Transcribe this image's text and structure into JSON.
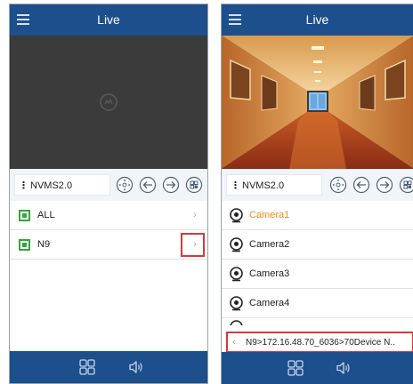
{
  "left_screen": {
    "title": "Live",
    "device": {
      "name": "NVMS2.0"
    },
    "list": [
      {
        "label": "ALL"
      },
      {
        "label": "N9"
      }
    ]
  },
  "right_screen": {
    "title": "Live",
    "device": {
      "name": "NVMS2.0"
    },
    "cameras": [
      {
        "label": "Camera1",
        "selected": true
      },
      {
        "label": "Camera2",
        "selected": false
      },
      {
        "label": "Camera3",
        "selected": false
      },
      {
        "label": "Camera4",
        "selected": false
      }
    ],
    "breadcrumb": "N9>172.16.48.70_6036>70Device N.."
  },
  "colors": {
    "header": "#1d4f8c",
    "checkbox": "#32a63c",
    "highlight_box": "#d33a3a",
    "selected_camera_text": "#f08c1a"
  },
  "icons": [
    "menu-icon",
    "ptz-icon",
    "prev-icon",
    "next-icon",
    "layout-icon",
    "chevron-right-icon",
    "camera-icon",
    "grid-icon",
    "speaker-icon"
  ]
}
